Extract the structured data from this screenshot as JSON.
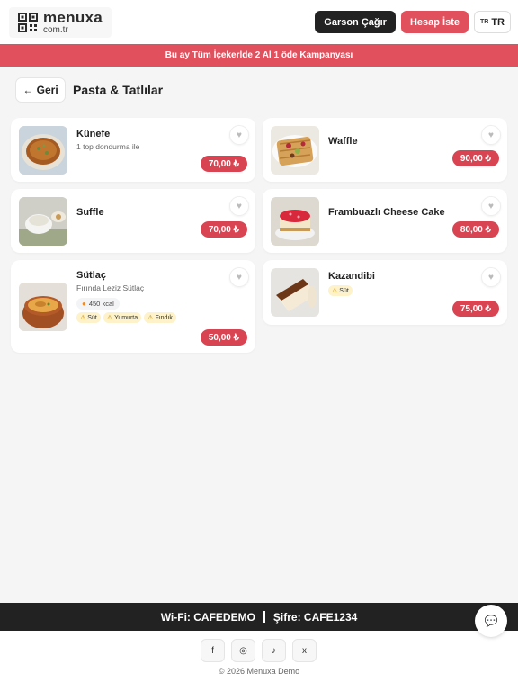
{
  "header": {
    "logo_name": "menuxa",
    "logo_domain": "com.tr",
    "waiter_button": "Garson Çağır",
    "bill_button": "Hesap İste",
    "lang_flag": "TR",
    "lang_code": "TR"
  },
  "banner": {
    "text": "Bu ay Tüm İçekerlde 2 Al 1 öde Kampanyası"
  },
  "subheader": {
    "back_label": "← Geri",
    "title": "Pasta & Tatlılar"
  },
  "products": [
    {
      "name": "Künefe",
      "description": "1 top dondurma ile",
      "price": "70,00 ₺",
      "image_icon": "kunefe-image"
    },
    {
      "name": "Waffle",
      "price": "90,00 ₺",
      "image_icon": "waffle-image"
    },
    {
      "name": "Suffle",
      "price": "70,00 ₺",
      "image_icon": "suffle-image"
    },
    {
      "name": "Frambuazlı Cheese Cake",
      "price": "80,00 ₺",
      "image_icon": "cheesecake-image"
    },
    {
      "name": "Sütlaç",
      "description": "Fırında Leziz Sütlaç",
      "kcal": "450 kcal",
      "allergens": [
        "Süt",
        "Yumurta",
        "Fındık"
      ],
      "price": "50,00 ₺",
      "image_icon": "sutlac-image"
    },
    {
      "name": "Kazandibi",
      "allergens": [
        "Süt"
      ],
      "price": "75,00 ₺",
      "image_icon": "kazandibi-image"
    }
  ],
  "icons": {
    "favorite": "heart-icon",
    "warning": "warning-icon",
    "flame": "flame-icon",
    "chat": "chat-icon"
  },
  "footer": {
    "wifi": "Wi-Fi: CAFEDEMO",
    "password": "Şifre: CAFE1234",
    "socials": [
      "f",
      "◎",
      "♪",
      "x"
    ],
    "copyright": "© 2026 Menuxa Demo"
  },
  "colors": {
    "accent": "#e0505d",
    "price": "#d94452",
    "dark": "#222222",
    "allergen_bg": "#fdf2c9"
  }
}
